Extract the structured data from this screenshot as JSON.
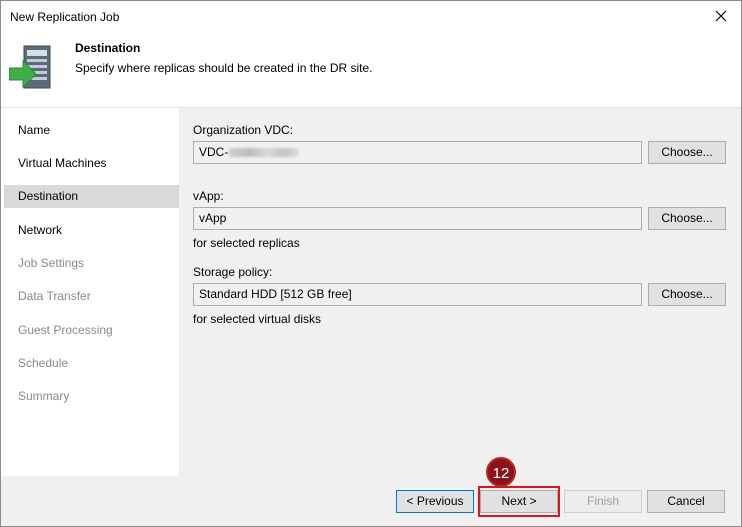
{
  "window": {
    "title": "New Replication Job"
  },
  "header": {
    "title": "Destination",
    "description": "Specify where replicas should be created in the DR site."
  },
  "sidebar": {
    "items": [
      {
        "label": "Name",
        "state": "normal"
      },
      {
        "label": "Virtual Machines",
        "state": "normal"
      },
      {
        "label": "Destination",
        "state": "active"
      },
      {
        "label": "Network",
        "state": "normal"
      },
      {
        "label": "Job Settings",
        "state": "disabled"
      },
      {
        "label": "Data Transfer",
        "state": "disabled"
      },
      {
        "label": "Guest Processing",
        "state": "disabled"
      },
      {
        "label": "Schedule",
        "state": "disabled"
      },
      {
        "label": "Summary",
        "state": "disabled"
      }
    ]
  },
  "form": {
    "org_vdc": {
      "label": "Organization VDC:",
      "value_prefix": "VDC-",
      "button": "Choose..."
    },
    "vapp": {
      "label": "vApp:",
      "value": "vApp",
      "button": "Choose...",
      "hint": "for selected replicas"
    },
    "storage": {
      "label": "Storage policy:",
      "value": "Standard HDD [512 GB free]",
      "button": "Choose...",
      "hint": "for selected virtual disks"
    }
  },
  "footer": {
    "previous": "< Previous",
    "next": "Next >",
    "finish": "Finish",
    "cancel": "Cancel"
  },
  "annotation": {
    "step": "12",
    "color": "#e0161b"
  }
}
